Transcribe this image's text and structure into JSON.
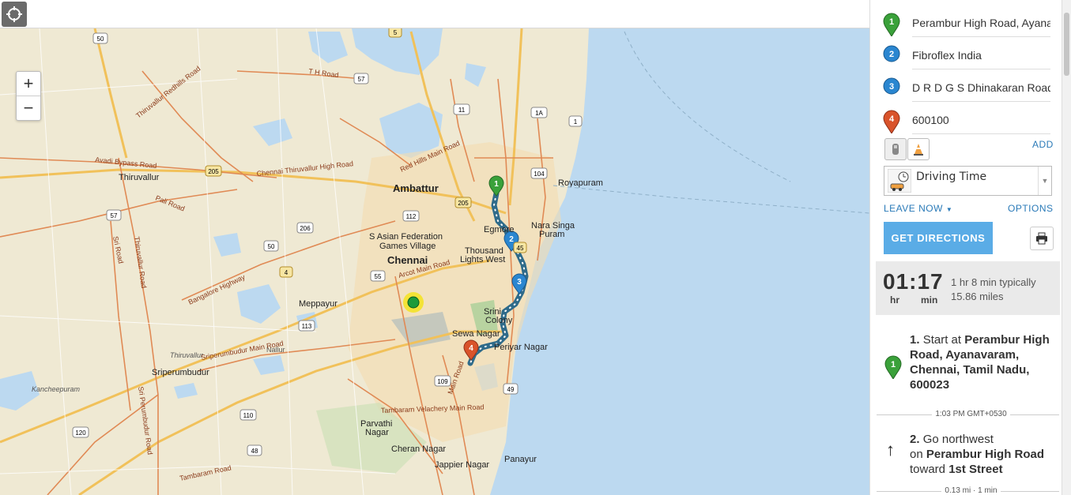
{
  "map": {
    "zoom_in": "+",
    "zoom_out": "−",
    "labels": {
      "thiruvallur": "Thiruvallur",
      "ambattur": "Ambattur",
      "royapuram": "Royapuram",
      "nara_singa_puram_1": "Nara Singa",
      "nara_singa_puram_2": "Puram",
      "egmore": "Egmore",
      "s_asian_1": "S Asian Federation",
      "s_asian_2": "Games Village",
      "chennai": "Chennai",
      "thousand_1": "Thousand",
      "thousand_2": "Lights West",
      "meppayur": "Meppayur",
      "srini_1": "Srini",
      "srini_2": "Colony",
      "sewa_nagar": "Sewa Nagar",
      "periyar_nagar": "Periyar Nagar",
      "sriperumbudur": "Sriperumbudur",
      "thiruvallur_small": "Thiruvallur",
      "nallur": "Nallur",
      "kancheepuram": "Kancheepuram",
      "parvathi_1": "Parvathi",
      "parvathi_2": "Nagar",
      "cheran_nagar": "Cheran Nagar",
      "jappier_nagar": "Jappier Nagar",
      "panayur": "Panayur",
      "tambaram_velachery": "Tambaram Velachery Main Road",
      "tambaram_road": "Tambaram Road",
      "avadi_bypass": "Avadi Bypass Road",
      "thiruvallur_redhills": "Thiruvallur Redhills Road",
      "th_road": "T H Road",
      "chennai_thiruvallur_high": "Chennai Thiruvallur High Road",
      "red_hills_main": "Red Hills Main Road",
      "pali_road": "Pali Road",
      "sriperumbudur_main": "Sriperumbudur Main Road",
      "bangalore_highway": "Bangalore Highway",
      "arcot_main": "Arcot Main Road",
      "sri_road": "Sri Road",
      "thiruvallur_road": "Thiruvallur Road",
      "sri_perumbudur_road": "Sri Perumbudur Road",
      "main_road": "Main Road"
    },
    "shields": [
      "50",
      "5",
      "57",
      "11",
      "1A",
      "1",
      "205",
      "104",
      "112",
      "206",
      "50",
      "4",
      "55",
      "45",
      "113",
      "109",
      "49",
      "110",
      "120",
      "48",
      "57",
      "205"
    ],
    "route_markers": [
      "1",
      "2",
      "3",
      "4"
    ],
    "colors": {
      "route": "#2f6b8a",
      "water": "#bcd9f0",
      "land": "#efe9d3",
      "major_road": "#e08a55",
      "highway": "#f1c15a"
    }
  },
  "panel": {
    "waypoints": [
      {
        "num": "1",
        "value": "Perambur High Road, Ayanavaram",
        "color": "#3aa13a"
      },
      {
        "num": "2",
        "value": "Fibroflex India",
        "color": "#2a86d0"
      },
      {
        "num": "3",
        "value": "D R D G S Dhinakaran Road",
        "color": "#2a86d0"
      },
      {
        "num": "4",
        "value": "600100",
        "color": "#d9532b"
      }
    ],
    "add_label": "ADD",
    "route_type": "Driving Time",
    "leave_now": "LEAVE NOW",
    "options": "OPTIONS",
    "get_directions": "GET DIRECTIONS",
    "summary": {
      "time": "01:17",
      "hr": "hr",
      "min": "min",
      "typically": "1 hr 8 min typically",
      "miles": "15.86 miles"
    },
    "steps": [
      {
        "num": "1.",
        "prefix": "Start at",
        "bold": "Perambur High Road, Ayanavaram, Chennai, Tamil Nadu, 600023"
      },
      {
        "num": "2.",
        "prefix": "Go northwest",
        "on": "on",
        "road": "Perambur High Road",
        "toward": "toward",
        "dest": "1st Street"
      }
    ],
    "time_divider": "1:03 PM GMT+0530",
    "dist_divider": "0.13 mi · 1 min"
  }
}
